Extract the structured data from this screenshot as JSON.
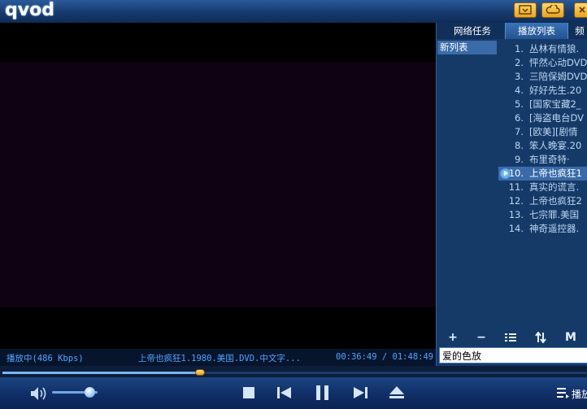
{
  "app": {
    "logo": "qvod"
  },
  "status": {
    "state": "播放中(486 Kbps)",
    "now_playing": "上帝也疯狂1.1980.美国.DVD.中文字...",
    "time": "00:36:49 / 01:48:49"
  },
  "tabs": [
    {
      "label": "网络任务",
      "active": false
    },
    {
      "label": "播放列表",
      "active": true
    },
    {
      "label": "频",
      "active": false
    }
  ],
  "lists": [
    {
      "label": "新列表"
    }
  ],
  "playlist": [
    {
      "num": "1.",
      "title": "丛林有情狼."
    },
    {
      "num": "2.",
      "title": "怦然心动DVD"
    },
    {
      "num": "3.",
      "title": "三陪保姆DVD"
    },
    {
      "num": "4.",
      "title": "好好先生.20"
    },
    {
      "num": "5.",
      "title": "[国家宝藏2_"
    },
    {
      "num": "6.",
      "title": "[海盗电台DV"
    },
    {
      "num": "7.",
      "title": "[欧美][剧情"
    },
    {
      "num": "8.",
      "title": "笨人晚宴.20"
    },
    {
      "num": "9.",
      "title": "布里奇特·"
    },
    {
      "num": "10.",
      "title": "上帝也疯狂1"
    },
    {
      "num": "11.",
      "title": "真实的谎言."
    },
    {
      "num": "12.",
      "title": "上帝也疯狂2"
    },
    {
      "num": "13.",
      "title": "七宗罪.美国"
    },
    {
      "num": "14.",
      "title": "神奇遥控器."
    }
  ],
  "playing_index": 9,
  "playlist_tools": {
    "add": "+",
    "remove": "−",
    "mode": "M"
  },
  "search": {
    "value": "爱的色放"
  },
  "progress": {
    "fraction": 0.338
  },
  "volume": {
    "fraction": 0.82
  },
  "bottom": {
    "label": "播放"
  },
  "colors": {
    "accent": "#4ea4ff",
    "panel": "#163a68",
    "thumb": "#f0b838"
  }
}
